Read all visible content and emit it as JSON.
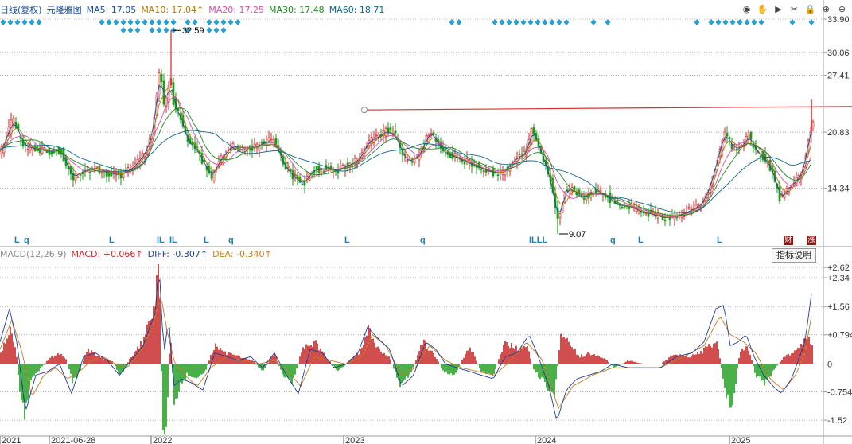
{
  "main_legend": {
    "title": "日线(复权)",
    "chart_name": "元隆雅图",
    "ma5": "MA5: 17.05",
    "ma10": "MA10: 17.04↑",
    "ma20": "MA20: 17.25",
    "ma30": "MA30: 17.48",
    "ma60": "MA60: 18.71"
  },
  "macd_legend": {
    "title": "MACD(12,26,9)",
    "macd": "MACD: +0.066↑",
    "diff": "DIFF: -0.307↑",
    "dea": "DEA: -0.340↑"
  },
  "toolbar": [
    {
      "name": "eye-icon",
      "glyph": "◉"
    },
    {
      "name": "hand-icon",
      "glyph": "✋"
    },
    {
      "name": "play-icon",
      "glyph": "▶"
    },
    {
      "name": "scissors-icon",
      "glyph": "✂"
    },
    {
      "name": "lock-icon",
      "glyph": "🔒"
    },
    {
      "name": "zoom-in-icon",
      "glyph": "⊕"
    },
    {
      "name": "zoom-out-icon",
      "glyph": "⊖"
    }
  ],
  "indicator_button": "指标说明",
  "tags": [
    "财",
    "涨"
  ],
  "colors": {
    "up": "#d42525",
    "down": "#179e17",
    "ma5": "#1a4fa0",
    "ma10": "#b37a00",
    "ma20": "#d24fb3",
    "ma30": "#1c8c1c",
    "ma60": "#0a6a8a",
    "diff": "#1f3d99",
    "dea": "#c27b1e",
    "trendline": "#d73030",
    "marker": "#2aa0d0"
  },
  "chart_data": [
    {
      "type": "candlestick",
      "y_axis_ticks": [
        "33.90",
        "30.06",
        "27.41",
        "20.83",
        "14.34"
      ],
      "y_range": [
        9.07,
        33.9
      ],
      "x_axis_labels": [
        "2021",
        "2021-06-28",
        "2022",
        "2023",
        "2024",
        "2025"
      ],
      "annotations": [
        "32.59",
        "9.07"
      ],
      "event_markers": [
        {
          "x": 18,
          "label": "L"
        },
        {
          "x": 30,
          "label": "q"
        },
        {
          "x": 137,
          "label": "L"
        },
        {
          "x": 197,
          "label": "IL"
        },
        {
          "x": 213,
          "label": "IL"
        },
        {
          "x": 256,
          "label": "L"
        },
        {
          "x": 287,
          "label": "q"
        },
        {
          "x": 433,
          "label": "L"
        },
        {
          "x": 528,
          "label": "q"
        },
        {
          "x": 665,
          "label": "ILLL"
        },
        {
          "x": 767,
          "label": "q"
        },
        {
          "x": 802,
          "label": "L"
        },
        {
          "x": 901,
          "label": "L"
        }
      ],
      "close_path": [
        [
          0,
          18.5
        ],
        [
          15,
          22.3
        ],
        [
          30,
          19.2
        ],
        [
          45,
          18.9
        ],
        [
          60,
          18.6
        ],
        [
          75,
          18.8
        ],
        [
          90,
          15.6
        ],
        [
          105,
          16.4
        ],
        [
          120,
          16.7
        ],
        [
          135,
          16.1
        ],
        [
          150,
          15.9
        ],
        [
          165,
          16.6
        ],
        [
          180,
          18.2
        ],
        [
          190,
          20.5
        ],
        [
          200,
          28.5
        ],
        [
          206,
          23.0
        ],
        [
          213,
          27.8
        ],
        [
          218,
          23.5
        ],
        [
          225,
          23.0
        ],
        [
          235,
          19.6
        ],
        [
          245,
          19.0
        ],
        [
          255,
          17.3
        ],
        [
          265,
          15.5
        ],
        [
          275,
          17.6
        ],
        [
          290,
          19.2
        ],
        [
          305,
          19.0
        ],
        [
          320,
          19.1
        ],
        [
          335,
          19.8
        ],
        [
          345,
          19.6
        ],
        [
          355,
          17.2
        ],
        [
          365,
          15.9
        ],
        [
          380,
          14.8
        ],
        [
          392,
          16.4
        ],
        [
          405,
          16.6
        ],
        [
          420,
          16.4
        ],
        [
          435,
          16.9
        ],
        [
          450,
          17.6
        ],
        [
          462,
          19.7
        ],
        [
          475,
          20.3
        ],
        [
          485,
          21.0
        ],
        [
          495,
          20.5
        ],
        [
          510,
          17.4
        ],
        [
          525,
          18.0
        ],
        [
          540,
          21.0
        ],
        [
          555,
          18.6
        ],
        [
          570,
          18.0
        ],
        [
          585,
          17.4
        ],
        [
          600,
          16.8
        ],
        [
          615,
          16.3
        ],
        [
          630,
          16.0
        ],
        [
          645,
          17.6
        ],
        [
          660,
          18.4
        ],
        [
          668,
          21.3
        ],
        [
          678,
          18.7
        ],
        [
          690,
          15.6
        ],
        [
          700,
          10.5
        ],
        [
          710,
          14.2
        ],
        [
          720,
          14.1
        ],
        [
          732,
          13.3
        ],
        [
          745,
          13.9
        ],
        [
          760,
          13.6
        ],
        [
          775,
          12.4
        ],
        [
          790,
          12.3
        ],
        [
          805,
          11.6
        ],
        [
          820,
          11.3
        ],
        [
          835,
          10.9
        ],
        [
          850,
          11.1
        ],
        [
          865,
          11.7
        ],
        [
          880,
          12.4
        ],
        [
          890,
          14.2
        ],
        [
          900,
          17.5
        ],
        [
          910,
          21.0
        ],
        [
          918,
          19.2
        ],
        [
          930,
          18.9
        ],
        [
          940,
          20.5
        ],
        [
          950,
          18.6
        ],
        [
          960,
          17.8
        ],
        [
          970,
          16.3
        ],
        [
          980,
          13.0
        ],
        [
          990,
          14.4
        ],
        [
          1000,
          15.2
        ],
        [
          1008,
          16.3
        ],
        [
          1016,
          20.5
        ],
        [
          1022,
          22.1
        ]
      ],
      "trendline": {
        "from": [
          458,
          23.4
        ],
        "to": [
          1071,
          23.8
        ]
      }
    },
    {
      "type": "macd",
      "y_axis_ticks": [
        "+2.62",
        "+2.34",
        "+1.56",
        "+0.794",
        "0",
        "-0.754",
        "-1.52"
      ],
      "y_range": [
        -1.95,
        2.75
      ],
      "diff_path": [
        [
          0,
          0.6
        ],
        [
          12,
          1.5
        ],
        [
          22,
          0.5
        ],
        [
          32,
          -1.3
        ],
        [
          45,
          -0.3
        ],
        [
          60,
          -0.2
        ],
        [
          75,
          0.0
        ],
        [
          90,
          -0.8
        ],
        [
          105,
          0.2
        ],
        [
          120,
          0.3
        ],
        [
          135,
          0.1
        ],
        [
          150,
          -0.3
        ],
        [
          165,
          0.1
        ],
        [
          180,
          0.5
        ],
        [
          195,
          1.4
        ],
        [
          200,
          2.7
        ],
        [
          206,
          0.2
        ],
        [
          212,
          1.3
        ],
        [
          218,
          -0.6
        ],
        [
          228,
          -0.4
        ],
        [
          240,
          -0.5
        ],
        [
          255,
          -0.7
        ],
        [
          270,
          0.3
        ],
        [
          285,
          0.2
        ],
        [
          300,
          0.1
        ],
        [
          315,
          0.2
        ],
        [
          330,
          -0.1
        ],
        [
          345,
          0.3
        ],
        [
          360,
          -0.3
        ],
        [
          375,
          -0.8
        ],
        [
          390,
          0.4
        ],
        [
          405,
          0.3
        ],
        [
          420,
          -0.1
        ],
        [
          435,
          0.0
        ],
        [
          450,
          0.3
        ],
        [
          462,
          1.0
        ],
        [
          475,
          0.7
        ],
        [
          490,
          0.4
        ],
        [
          505,
          -0.6
        ],
        [
          520,
          -0.3
        ],
        [
          535,
          0.6
        ],
        [
          548,
          0.4
        ],
        [
          560,
          0.0
        ],
        [
          575,
          -0.1
        ],
        [
          590,
          -0.2
        ],
        [
          605,
          -0.3
        ],
        [
          620,
          -0.4
        ],
        [
          635,
          0.2
        ],
        [
          650,
          0.3
        ],
        [
          665,
          0.8
        ],
        [
          675,
          0.3
        ],
        [
          690,
          -0.6
        ],
        [
          700,
          -1.55
        ],
        [
          712,
          -0.7
        ],
        [
          725,
          -0.4
        ],
        [
          740,
          -0.3
        ],
        [
          755,
          -0.2
        ],
        [
          770,
          0.0
        ],
        [
          790,
          -0.1
        ],
        [
          810,
          -0.1
        ],
        [
          830,
          -0.1
        ],
        [
          850,
          0.2
        ],
        [
          870,
          0.3
        ],
        [
          885,
          0.6
        ],
        [
          900,
          1.5
        ],
        [
          910,
          1.6
        ],
        [
          918,
          0.5
        ],
        [
          928,
          0.6
        ],
        [
          938,
          0.8
        ],
        [
          948,
          0.2
        ],
        [
          960,
          -0.3
        ],
        [
          972,
          -0.6
        ],
        [
          982,
          -0.8
        ],
        [
          995,
          -0.4
        ],
        [
          1005,
          0.2
        ],
        [
          1012,
          0.6
        ],
        [
          1020,
          1.9
        ]
      ],
      "dea_path": [
        [
          0,
          0.4
        ],
        [
          15,
          1.2
        ],
        [
          28,
          0.3
        ],
        [
          40,
          -0.9
        ],
        [
          55,
          -0.3
        ],
        [
          70,
          -0.1
        ],
        [
          85,
          -0.4
        ],
        [
          100,
          -0.2
        ],
        [
          115,
          0.1
        ],
        [
          130,
          0.2
        ],
        [
          145,
          0.0
        ],
        [
          160,
          -0.1
        ],
        [
          175,
          0.3
        ],
        [
          192,
          1.0
        ],
        [
          202,
          1.9
        ],
        [
          210,
          0.9
        ],
        [
          220,
          0.0
        ],
        [
          232,
          -0.3
        ],
        [
          248,
          -0.6
        ],
        [
          265,
          -0.1
        ],
        [
          285,
          0.2
        ],
        [
          305,
          0.1
        ],
        [
          325,
          0.0
        ],
        [
          345,
          0.1
        ],
        [
          362,
          -0.2
        ],
        [
          378,
          -0.6
        ],
        [
          395,
          0.2
        ],
        [
          415,
          0.1
        ],
        [
          435,
          0.0
        ],
        [
          455,
          0.2
        ],
        [
          468,
          0.8
        ],
        [
          485,
          0.5
        ],
        [
          505,
          -0.3
        ],
        [
          522,
          -0.1
        ],
        [
          540,
          0.5
        ],
        [
          560,
          0.1
        ],
        [
          580,
          -0.1
        ],
        [
          600,
          -0.2
        ],
        [
          622,
          -0.3
        ],
        [
          642,
          0.1
        ],
        [
          662,
          0.6
        ],
        [
          682,
          0.1
        ],
        [
          702,
          -1.2
        ],
        [
          720,
          -0.6
        ],
        [
          745,
          -0.3
        ],
        [
          770,
          -0.1
        ],
        [
          800,
          -0.1
        ],
        [
          830,
          -0.1
        ],
        [
          860,
          0.2
        ],
        [
          885,
          0.5
        ],
        [
          905,
          1.3
        ],
        [
          918,
          0.8
        ],
        [
          935,
          0.6
        ],
        [
          950,
          0.3
        ],
        [
          968,
          -0.4
        ],
        [
          985,
          -0.7
        ],
        [
          1000,
          -0.3
        ],
        [
          1012,
          0.3
        ],
        [
          1020,
          1.3
        ]
      ],
      "histogram": [
        [
          0,
          0.3
        ],
        [
          8,
          0.6
        ],
        [
          14,
          1.0
        ],
        [
          20,
          0.4
        ],
        [
          26,
          -1.0
        ],
        [
          32,
          -1.4
        ],
        [
          38,
          -0.5
        ],
        [
          48,
          -0.2
        ],
        [
          60,
          0.1
        ],
        [
          72,
          0.3
        ],
        [
          82,
          0.2
        ],
        [
          92,
          -0.5
        ],
        [
          100,
          -0.2
        ],
        [
          110,
          0.4
        ],
        [
          125,
          0.2
        ],
        [
          140,
          0.1
        ],
        [
          152,
          -0.3
        ],
        [
          165,
          0.2
        ],
        [
          180,
          0.6
        ],
        [
          190,
          1.2
        ],
        [
          196,
          2.0
        ],
        [
          200,
          2.5
        ],
        [
          205,
          -2.0
        ],
        [
          210,
          -1.5
        ],
        [
          214,
          0.9
        ],
        [
          219,
          -1.0
        ],
        [
          226,
          -0.6
        ],
        [
          235,
          -0.3
        ],
        [
          248,
          -0.4
        ],
        [
          258,
          -0.2
        ],
        [
          270,
          0.5
        ],
        [
          285,
          0.3
        ],
        [
          300,
          0.2
        ],
        [
          318,
          0.1
        ],
        [
          330,
          -0.2
        ],
        [
          345,
          0.3
        ],
        [
          355,
          -0.3
        ],
        [
          368,
          -0.5
        ],
        [
          380,
          0.4
        ],
        [
          395,
          0.6
        ],
        [
          410,
          0.2
        ],
        [
          425,
          -0.2
        ],
        [
          440,
          0.1
        ],
        [
          455,
          0.4
        ],
        [
          463,
          0.9
        ],
        [
          478,
          0.3
        ],
        [
          490,
          0.2
        ],
        [
          502,
          -0.6
        ],
        [
          515,
          -0.3
        ],
        [
          532,
          0.6
        ],
        [
          545,
          0.3
        ],
        [
          558,
          -0.2
        ],
        [
          572,
          -0.3
        ],
        [
          590,
          0.5
        ],
        [
          605,
          -0.2
        ],
        [
          620,
          -0.3
        ],
        [
          635,
          0.6
        ],
        [
          650,
          0.4
        ],
        [
          662,
          0.5
        ],
        [
          672,
          -0.2
        ],
        [
          686,
          -0.5
        ],
        [
          696,
          -1.0
        ],
        [
          705,
          0.7
        ],
        [
          715,
          0.6
        ],
        [
          728,
          0.2
        ],
        [
          742,
          0.3
        ],
        [
          758,
          0.2
        ],
        [
          772,
          -0.1
        ],
        [
          790,
          0.1
        ],
        [
          810,
          0.0
        ],
        [
          830,
          0.0
        ],
        [
          850,
          0.3
        ],
        [
          865,
          0.2
        ],
        [
          880,
          0.3
        ],
        [
          892,
          0.5
        ],
        [
          902,
          0.6
        ],
        [
          912,
          -0.8
        ],
        [
          920,
          -1.2
        ],
        [
          930,
          0.3
        ],
        [
          940,
          0.5
        ],
        [
          950,
          -0.3
        ],
        [
          962,
          -0.5
        ],
        [
          972,
          -0.2
        ],
        [
          985,
          0.2
        ],
        [
          998,
          0.3
        ],
        [
          1008,
          0.5
        ],
        [
          1016,
          0.8
        ],
        [
          1022,
          0.4
        ]
      ]
    }
  ]
}
